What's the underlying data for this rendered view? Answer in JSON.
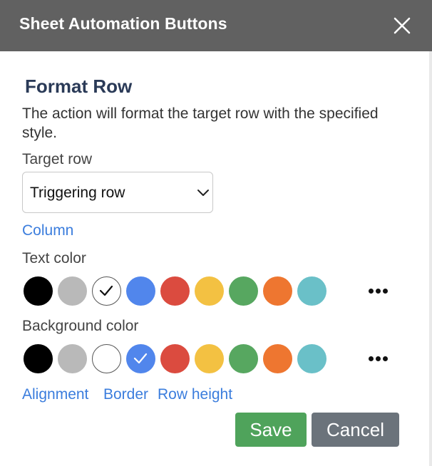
{
  "dialog": {
    "title": "Sheet Automation Buttons",
    "close_icon": "close-icon"
  },
  "section": {
    "heading": "Format Row",
    "description": "The action will format the target row with the specified style."
  },
  "target_row": {
    "label": "Target row",
    "value": "Triggering row"
  },
  "links": {
    "column": "Column",
    "alignment": "Alignment",
    "border": "Border",
    "row_height": "Row height"
  },
  "text_color": {
    "label": "Text color",
    "selected": "white",
    "swatches": [
      {
        "name": "black",
        "color": "#000000"
      },
      {
        "name": "gray",
        "color": "#b9b9b9"
      },
      {
        "name": "white",
        "color": "#ffffff"
      },
      {
        "name": "blue",
        "color": "#5186ec"
      },
      {
        "name": "red",
        "color": "#db4b3f"
      },
      {
        "name": "yellow",
        "color": "#f3c142"
      },
      {
        "name": "green",
        "color": "#57a760"
      },
      {
        "name": "orange",
        "color": "#ee7630"
      },
      {
        "name": "teal",
        "color": "#6ac0c8"
      }
    ]
  },
  "background_color": {
    "label": "Background color",
    "selected": "blue",
    "swatches": [
      {
        "name": "black",
        "color": "#000000"
      },
      {
        "name": "gray",
        "color": "#b9b9b9"
      },
      {
        "name": "white",
        "color": "#ffffff"
      },
      {
        "name": "blue",
        "color": "#5186ec"
      },
      {
        "name": "red",
        "color": "#db4b3f"
      },
      {
        "name": "yellow",
        "color": "#f3c142"
      },
      {
        "name": "green",
        "color": "#57a760"
      },
      {
        "name": "orange",
        "color": "#ee7630"
      },
      {
        "name": "teal",
        "color": "#6ac0c8"
      }
    ]
  },
  "buttons": {
    "save": "Save",
    "cancel": "Cancel"
  }
}
